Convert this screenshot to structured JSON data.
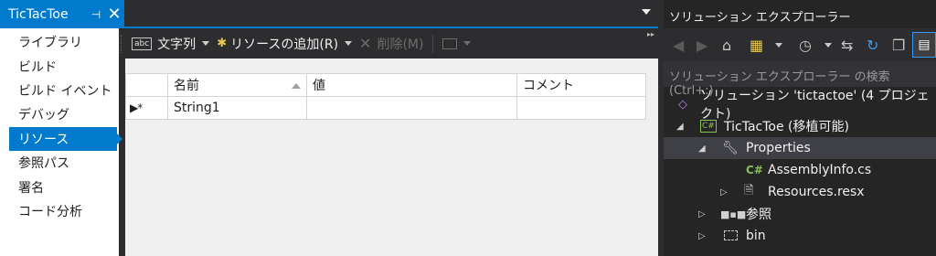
{
  "document_tab": {
    "title": "TicTacToe"
  },
  "left_nav": {
    "items": [
      {
        "label": "ライブラリ",
        "active": false
      },
      {
        "label": "ビルド",
        "active": false
      },
      {
        "label": "ビルド イベント",
        "active": false
      },
      {
        "label": "デバッグ",
        "active": false
      },
      {
        "label": "リソース",
        "active": true
      },
      {
        "label": "参照パス",
        "active": false
      },
      {
        "label": "署名",
        "active": false
      },
      {
        "label": "コード分析",
        "active": false
      }
    ]
  },
  "resource_toolbar": {
    "strings_label": "文字列",
    "add_resource_label": "リソースの追加(R)",
    "remove_label": "削除(M)",
    "strings_icon_text": "abc"
  },
  "grid": {
    "columns": [
      "名前",
      "値",
      "コメント"
    ],
    "rows": [
      {
        "marker": "▶*",
        "name": "String1",
        "value": "",
        "comment": ""
      }
    ]
  },
  "solution_explorer": {
    "title": "ソリューション エクスプローラー",
    "search_placeholder": "ソリューション エクスプローラー の検索 (Ctrl+:)",
    "tree": [
      {
        "label": "ソリューション 'tictactoe' (4 プロジェクト)",
        "icon": "solution-icon"
      },
      {
        "label": "TicTacToe (移植可能)",
        "icon": "csharp-project-icon",
        "project_icon_text": "C#"
      },
      {
        "label": "Properties",
        "icon": "wrench-icon"
      },
      {
        "label": "AssemblyInfo.cs",
        "icon": "csharp-file-icon",
        "file_icon_text": "C#"
      },
      {
        "label": "Resources.resx",
        "icon": "resx-file-icon"
      },
      {
        "label": "参照",
        "icon": "references-icon"
      },
      {
        "label": "bin",
        "icon": "hidden-folder-icon"
      }
    ]
  },
  "colors": {
    "accent": "#007acc",
    "dark_background": "#2d2d30",
    "tree_background": "#252526"
  }
}
